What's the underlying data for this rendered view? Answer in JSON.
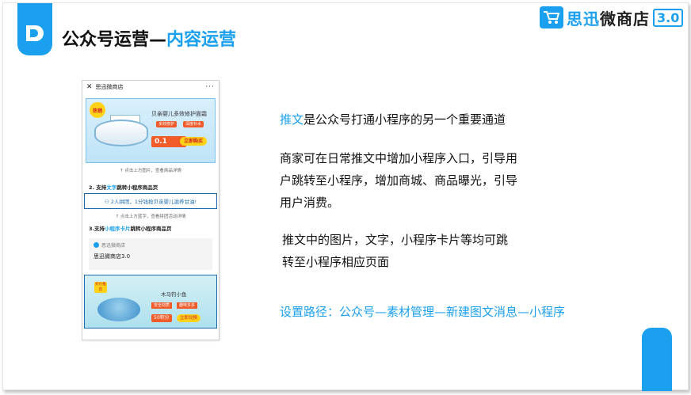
{
  "title": {
    "main": "公众号运营—",
    "highlight": "内容运营"
  },
  "logo": {
    "brand_blue": "思迅",
    "brand_dark": "微商店",
    "version": "3.0"
  },
  "phone": {
    "header_close": "✕",
    "header_title": "思迅微商店",
    "header_menu": "···",
    "card1": {
      "hot": "热销",
      "product": "贝亲婴儿多效修护面霜",
      "tag1": "多效修护",
      "tag2": "深度补水",
      "price": "0.1",
      "buy": "立即购买"
    },
    "note1": "↑ 点击上方图片，查看商品详情",
    "section2_prefix": "2. 支持",
    "section2_hl": "文字",
    "section2_suffix": "跳转小程序商品页",
    "link_text": "⚇ 2人拼团，1分钱抢贝亲婴儿滋养甘油!",
    "note2": "↑ 点击上方蓝字，查看拼团活动详情",
    "section3_prefix": "3.支持",
    "section3_hl": "小程序卡片",
    "section3_suffix": "跳转小程序商品页",
    "mini": {
      "source": "思迅微商店",
      "name": "思迅微商店3.0"
    },
    "card2": {
      "hot": "好价推荐",
      "product": "木马钓小鱼",
      "tag1": "安全材质",
      "tag2": "趣味多多",
      "points": "50积分",
      "exchange": "立即兑换"
    }
  },
  "right": {
    "p1_hl": "推文",
    "p1_rest": "是公众号打通小程序的另一个重要通道",
    "p2_line1": "商家可在日常推文中增加小程序入口，引导用",
    "p2_line2": "户跳转至小程序，增加商城、商品曝光，引导",
    "p2_line3": "用户消费。",
    "p3_line1": "推文中的图片，文字，小程序卡片等均可跳",
    "p3_line2": "转至小程序相应页面",
    "path": "设置路径：公众号—素材管理—新建图文消息—小程序"
  },
  "colors": {
    "accent": "#1aa0ee",
    "text": "#111111",
    "orange": "#f15a29",
    "yellow": "#ffd21a"
  }
}
